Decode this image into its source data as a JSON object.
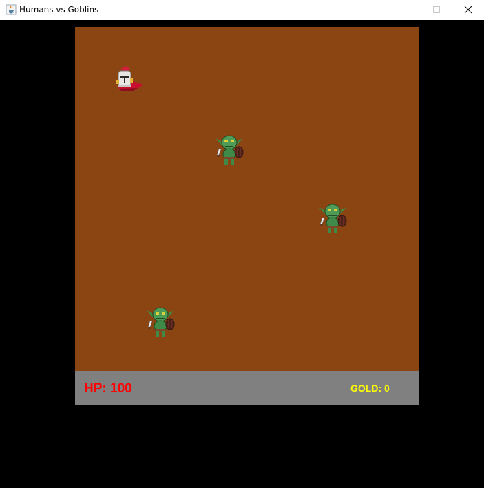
{
  "window": {
    "title": "Humans vs Goblins",
    "app_icon": "java-cup-icon",
    "controls": [
      "minimize-icon",
      "maximize-icon",
      "close-icon"
    ]
  },
  "board": {
    "ground_color": "#8B4512",
    "player": {
      "name": "knight",
      "icon": "knight-icon"
    },
    "enemies": [
      {
        "name": "goblin",
        "icon": "goblin-icon"
      },
      {
        "name": "goblin",
        "icon": "goblin-icon"
      },
      {
        "name": "goblin",
        "icon": "goblin-icon"
      }
    ]
  },
  "hud": {
    "hp_text": "HP: 100",
    "gold_text": "GOLD: 0",
    "hp_color": "#ff0000",
    "gold_color": "#ffff00",
    "background": "#808080"
  }
}
